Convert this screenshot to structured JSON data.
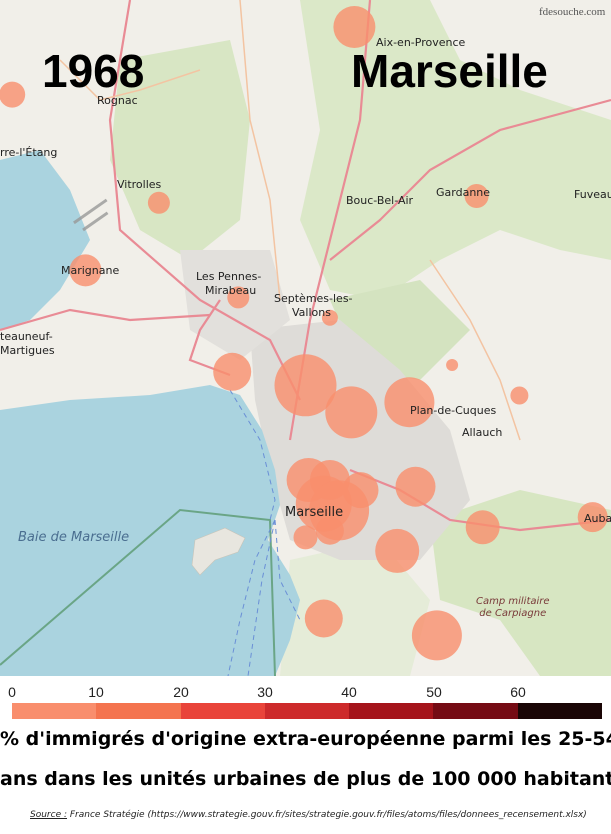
{
  "header": {
    "year": "1968",
    "city": "Marseille",
    "watermark": "fdesouche.com"
  },
  "places": [
    {
      "id": "aix",
      "label": "Aix-en-Provence"
    },
    {
      "id": "rognac",
      "label": "Rognac"
    },
    {
      "id": "berre",
      "label": "rre-l'Étang"
    },
    {
      "id": "vitrolles",
      "label": "Vitrolles"
    },
    {
      "id": "bouc",
      "label": "Bouc-Bel-Air"
    },
    {
      "id": "gardanne",
      "label": "Gardanne"
    },
    {
      "id": "fuveau",
      "label": "Fuveau"
    },
    {
      "id": "marignane",
      "label": "Marignane"
    },
    {
      "id": "pennes",
      "label": "Les Pennes-"
    },
    {
      "id": "mirabeau",
      "label": "Mirabeau"
    },
    {
      "id": "septemes",
      "label": "Septèmes-les-"
    },
    {
      "id": "vallons",
      "label": "Vallons"
    },
    {
      "id": "chateauneuf",
      "label": "teauneuf-"
    },
    {
      "id": "martigues",
      "label": "Martigues"
    },
    {
      "id": "plan",
      "label": "Plan-de-Cuques"
    },
    {
      "id": "allauch",
      "label": "Allauch"
    },
    {
      "id": "marseille",
      "label": "Marseille"
    },
    {
      "id": "aubagne",
      "label": "Auba"
    }
  ],
  "bay_label": "Baie de Marseille",
  "camp_label": [
    "Camp militaire",
    "de Carpiagne"
  ],
  "legend": {
    "ticks": [
      "0",
      "10",
      "20",
      "30",
      "40",
      "50",
      "60"
    ],
    "colors": [
      "#f98e6d",
      "#f4744f",
      "#e9443a",
      "#cd2a2b",
      "#a5141b",
      "#750b14",
      "#1a0505"
    ]
  },
  "circles": [
    {
      "lon": 0.58,
      "lat": 0.04,
      "r": 21
    },
    {
      "lon": 0.02,
      "lat": 0.14,
      "r": 13
    },
    {
      "lon": 0.26,
      "lat": 0.3,
      "r": 11
    },
    {
      "lon": 0.78,
      "lat": 0.29,
      "r": 12
    },
    {
      "lon": 0.14,
      "lat": 0.4,
      "r": 16
    },
    {
      "lon": 0.39,
      "lat": 0.44,
      "r": 11
    },
    {
      "lon": 0.54,
      "lat": 0.47,
      "r": 8
    },
    {
      "lon": 0.74,
      "lat": 0.54,
      "r": 6
    },
    {
      "lon": 0.85,
      "lat": 0.585,
      "r": 9
    },
    {
      "lon": 0.38,
      "lat": 0.55,
      "r": 19
    },
    {
      "lon": 0.5,
      "lat": 0.57,
      "r": 31
    },
    {
      "lon": 0.575,
      "lat": 0.61,
      "r": 26
    },
    {
      "lon": 0.67,
      "lat": 0.595,
      "r": 25
    },
    {
      "lon": 0.505,
      "lat": 0.71,
      "r": 22
    },
    {
      "lon": 0.54,
      "lat": 0.71,
      "r": 20
    },
    {
      "lon": 0.59,
      "lat": 0.725,
      "r": 18
    },
    {
      "lon": 0.53,
      "lat": 0.745,
      "r": 28
    },
    {
      "lon": 0.555,
      "lat": 0.755,
      "r": 30
    },
    {
      "lon": 0.68,
      "lat": 0.72,
      "r": 20
    },
    {
      "lon": 0.5,
      "lat": 0.795,
      "r": 12
    },
    {
      "lon": 0.54,
      "lat": 0.785,
      "r": 14
    },
    {
      "lon": 0.79,
      "lat": 0.78,
      "r": 17
    },
    {
      "lon": 0.97,
      "lat": 0.765,
      "r": 15
    },
    {
      "lon": 0.65,
      "lat": 0.815,
      "r": 22
    },
    {
      "lon": 0.53,
      "lat": 0.915,
      "r": 19
    },
    {
      "lon": 0.715,
      "lat": 0.94,
      "r": 25
    }
  ]
}
